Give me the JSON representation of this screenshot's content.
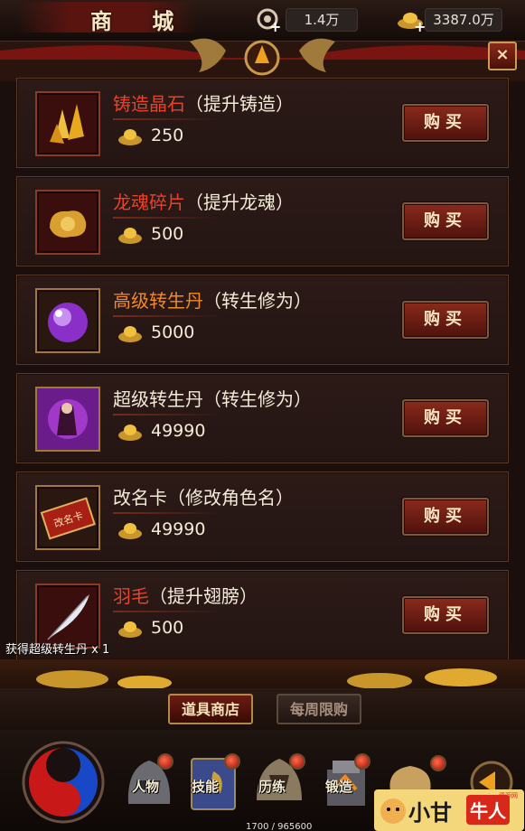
{
  "header": {
    "title": "商 城",
    "currency1": "1.4万",
    "currency2": "3387.0万",
    "plus": "+",
    "close": "×"
  },
  "items": [
    {
      "name": "铸造晶石",
      "desc": "（提升铸造）",
      "price": "250",
      "buy": "购买",
      "icon": "crystal-icon"
    },
    {
      "name": "龙魂碎片",
      "desc": "（提升龙魂）",
      "price": "500",
      "buy": "购买",
      "icon": "dragon-soul-icon"
    },
    {
      "name": "高级转生丹",
      "desc": "（转生修为）",
      "price": "5000",
      "buy": "购买",
      "icon": "purple-orb-icon"
    },
    {
      "name": "超级转生丹",
      "desc": "（转生修为）",
      "price": "49990",
      "buy": "购买",
      "icon": "rebirth-pill-icon"
    },
    {
      "name": "改名卡",
      "desc": "（修改角色名）",
      "price": "49990",
      "buy": "购买",
      "icon": "rename-card-icon"
    },
    {
      "name": "羽毛",
      "desc": "（提升翅膀）",
      "price": "500",
      "buy": "购买",
      "icon": "feather-icon"
    }
  ],
  "rename_card_text": "改名卡",
  "notice": "获得超级转生丹 x 1",
  "tabs": {
    "active": "道具商店",
    "inactive": "每周限购"
  },
  "nav": [
    {
      "label": "人物",
      "icon": "character-icon"
    },
    {
      "label": "技能",
      "icon": "skill-icon"
    },
    {
      "label": "历练",
      "icon": "training-icon"
    },
    {
      "label": "锻造",
      "icon": "forge-icon"
    }
  ],
  "exp": "1700 / 965600",
  "watermark": {
    "a": "小甘",
    "b": "牛人",
    "tiny": "资源网"
  }
}
